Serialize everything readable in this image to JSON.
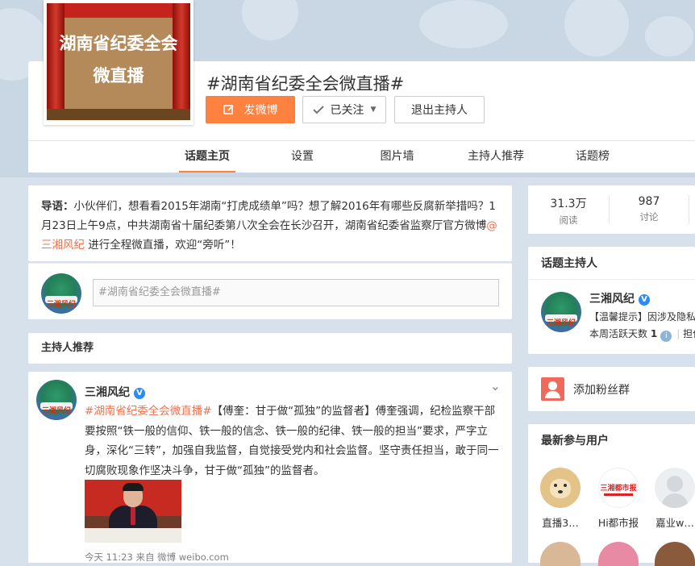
{
  "topic": {
    "picture_line1": "湖南省纪委全会",
    "picture_line2": "微直播",
    "title": "#湖南省纪委全会微直播#",
    "post_button": "发微博",
    "follow_button": "已关注",
    "exit_host_button": "退出主持人"
  },
  "nav": {
    "tabs": [
      "话题主页",
      "设置",
      "图片墙",
      "主持人推荐",
      "话题榜"
    ],
    "active": "话题主页"
  },
  "intro": {
    "label": "导语：",
    "text_before": "小伙伴们，想看看2015年湖南“打虎成绩单”吗？想了解2016年有哪些反腐新举措吗？1月23日上午9点，中共湖南省十届纪委第八次全会在长沙召开，湖南省纪委省监察厅官方微博",
    "mention": "@三湘风纪",
    "text_after": " 进行全程微直播，欢迎“旁听”！"
  },
  "composer": {
    "placeholder": "#湖南省纪委全会微直播#",
    "avatar_text": "三湘风纪"
  },
  "host_recommend": {
    "title": "主持人推荐"
  },
  "post": {
    "author": "三湘风纪",
    "verified": "V",
    "topic": "#湖南省纪委全会微直播#",
    "text": "【傅奎：甘于做“孤独”的监督者】傅奎强调，纪检监察干部要按照“铁一般的信仰、铁一般的信念、铁一般的纪律、铁一般的担当”要求，严字立身，深化“三转”，加强自我监督，自觉接受党内和社会监督。坚守责任担当，敢于同一切腐败现象作坚决斗争，甘于做“孤独”的监督者。",
    "meta": "今天 11:23 来自 微博 weibo.com"
  },
  "stats": {
    "reads": "31.3万",
    "reads_label": "阅读",
    "discussions": "987",
    "discussions_label": "讨论"
  },
  "host_panel": {
    "title": "话题主持人",
    "name": "三湘风纪",
    "tip": "【温馨提示】因涉及隐私",
    "days_label": "本周活跃天数",
    "days": "1",
    "extra": "担任"
  },
  "fans": {
    "label": "添加粉丝群"
  },
  "users_panel": {
    "title": "最新参与用户",
    "users": [
      {
        "name": "直播3…"
      },
      {
        "name": "Hi都市报",
        "logo_text": "三湘都市报"
      },
      {
        "name": "嘉业w…"
      }
    ]
  },
  "colors": {
    "accent": "#ff8140",
    "link": "#eb7350",
    "verify": "#2d8bf1"
  }
}
